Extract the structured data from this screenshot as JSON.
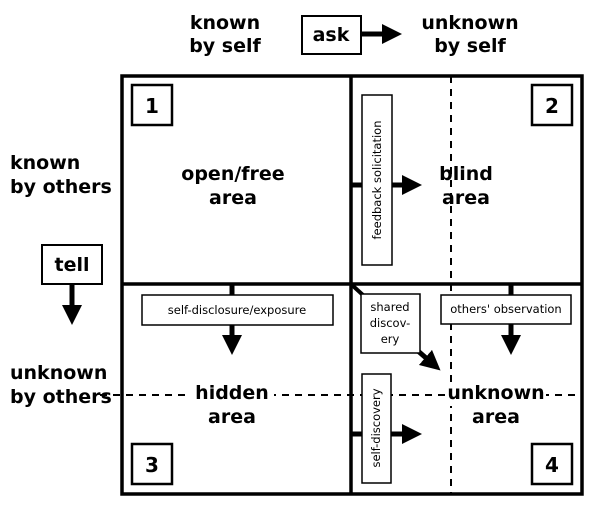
{
  "axes": {
    "known_by_self": [
      "known",
      "by self"
    ],
    "unknown_by_self": [
      "unknown",
      "by self"
    ],
    "known_by_others": [
      "known",
      "by others"
    ],
    "unknown_by_others": [
      "unknown",
      "by others"
    ],
    "ask": "ask",
    "tell": "tell"
  },
  "quadrants": [
    {
      "number": "1",
      "label": [
        "open/free",
        "area"
      ]
    },
    {
      "number": "2",
      "label": [
        "blind",
        "area"
      ]
    },
    {
      "number": "3",
      "label": [
        "hidden",
        "area"
      ]
    },
    {
      "number": "4",
      "label": [
        "unknown",
        "area"
      ]
    }
  ],
  "processes": {
    "feedback": "feedback solicitation",
    "self_disclosure": "self-disclosure/exposure",
    "shared_discovery": [
      "shared",
      "discov-",
      "ery"
    ],
    "others_observation": "others' observation",
    "self_discovery": "self-discovery"
  }
}
